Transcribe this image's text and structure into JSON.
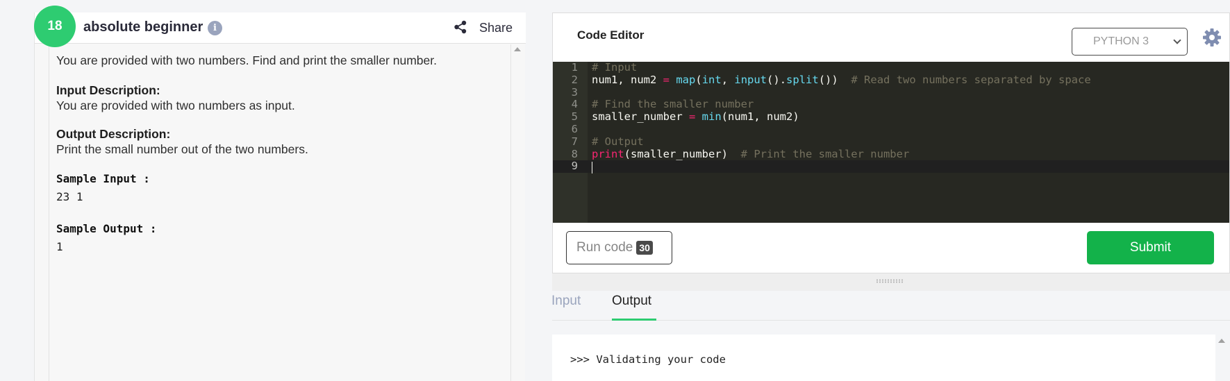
{
  "problem": {
    "level_number": "18",
    "title": "absolute beginner",
    "info_icon": "info-icon",
    "share_label": "Share",
    "statement": "You are provided with two numbers. Find and print the smaller number.",
    "input_heading": "Input Description:",
    "input_text": "You are provided with two numbers as input.",
    "output_heading": "Output Description:",
    "output_text": "Print the small number out of the two numbers.",
    "sample_input_heading": "Sample Input :",
    "sample_input": "23 1",
    "sample_output_heading": "Sample Output :",
    "sample_output": "1"
  },
  "editor": {
    "title": "Code Editor",
    "language": "PYTHON 3",
    "settings_icon": "gear-icon",
    "lines": [
      {
        "n": "1",
        "segments": [
          {
            "text": "# Input",
            "cls": "c-cmt"
          }
        ]
      },
      {
        "n": "2",
        "segments": [
          {
            "text": "num1, num2 ",
            "cls": ""
          },
          {
            "text": "=",
            "cls": "c-op"
          },
          {
            "text": " ",
            "cls": ""
          },
          {
            "text": "map",
            "cls": "c-fn"
          },
          {
            "text": "(",
            "cls": ""
          },
          {
            "text": "int",
            "cls": "c-fn"
          },
          {
            "text": ", ",
            "cls": ""
          },
          {
            "text": "input",
            "cls": "c-fn"
          },
          {
            "text": "().",
            "cls": ""
          },
          {
            "text": "split",
            "cls": "c-fn"
          },
          {
            "text": "())  ",
            "cls": ""
          },
          {
            "text": "# Read two numbers separated by space",
            "cls": "c-cmt"
          }
        ]
      },
      {
        "n": "3",
        "segments": []
      },
      {
        "n": "4",
        "segments": [
          {
            "text": "# Find the smaller number",
            "cls": "c-cmt"
          }
        ]
      },
      {
        "n": "5",
        "segments": [
          {
            "text": "smaller_number ",
            "cls": ""
          },
          {
            "text": "=",
            "cls": "c-op"
          },
          {
            "text": " ",
            "cls": ""
          },
          {
            "text": "min",
            "cls": "c-fn"
          },
          {
            "text": "(num1, num2)",
            "cls": ""
          }
        ]
      },
      {
        "n": "6",
        "segments": []
      },
      {
        "n": "7",
        "segments": [
          {
            "text": "# Output",
            "cls": "c-cmt"
          }
        ]
      },
      {
        "n": "8",
        "segments": [
          {
            "text": "print",
            "cls": "c-op"
          },
          {
            "text": "(smaller_number)  ",
            "cls": ""
          },
          {
            "text": "# Print the smaller number",
            "cls": "c-cmt"
          }
        ]
      },
      {
        "n": "9",
        "segments": [],
        "active": true
      }
    ],
    "run_label": "Run code",
    "run_count": "30",
    "submit_label": "Submit"
  },
  "console": {
    "tabs": [
      {
        "label": "Input",
        "active": false
      },
      {
        "label": "Output",
        "active": true
      }
    ],
    "output_text": ">>> Validating your code"
  },
  "colors": {
    "accent_green": "#2ecc71",
    "submit_green": "#13b24a",
    "editor_bg": "#272822"
  }
}
